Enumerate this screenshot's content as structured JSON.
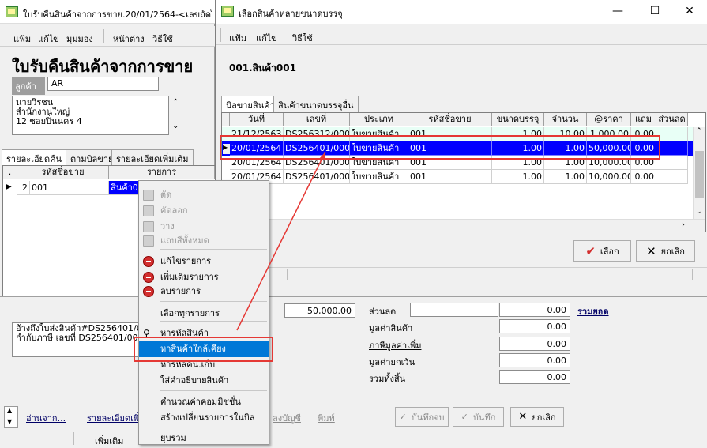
{
  "back_window": {
    "title": "ใบรับคืนสินค้าจากการขาย.20/01/2564-<เลขถัดไป> ,",
    "menu": [
      "แฟ้ม",
      "แก้ไข",
      "มุมมอง",
      "หน้าต่าง",
      "วิธีใช้"
    ],
    "heading": "ใบรับคืนสินค้าจากการขาย",
    "customer_label": "ลูกค้า",
    "customer_code": "AR",
    "address_lines": [
      "นายวิรชน",
      "สำนักงานใหญ่",
      "12 ซอยปิ่นนคร 4"
    ],
    "tabs": [
      "รายละเอียดคืน",
      "ตามบิลขาย",
      "รายละเอียดเพิ่มเติม"
    ],
    "grid_headers": [
      ".",
      "รหัสชื่อขาย",
      "รายการ"
    ],
    "grid_row": {
      "no": "2",
      "code": "001",
      "item": "สินค้า001"
    },
    "reference_lines": [
      "อ้างถึงใบส่งสินค้า#DS256401/0000",
      "กำกับภาษี เลขที่ DS256401/0000"
    ],
    "bottom_links": [
      "อ่านจาก...",
      "รายละเอียดเพิ่ม"
    ],
    "extra_links": [
      "ลงบัญชี",
      "พิมพ์"
    ],
    "status_add": "เพิ่มเติม",
    "amount_value": "50,000.00",
    "summary": {
      "discount_label": "ส่วนลด",
      "discount_value": "0.00",
      "goods_value_label": "มูลค่าสินค้า",
      "goods_value": "0.00",
      "vat_label": "ภาษีมูลค่าเพิ่ม",
      "vat_value": "0.00",
      "exempt_label": "มูลค่ายกเว้น",
      "exempt_value": "0.00",
      "total_label": "รวมทั้งสิ้น",
      "total_value": "0.00",
      "sum_link": "รวมยอด"
    },
    "buttons": {
      "save_print": "บันทึกจบ",
      "save": "บันทึก",
      "cancel": "ยกเลิก"
    }
  },
  "context_menu": {
    "items": [
      {
        "label": "ตัด",
        "disabled": true
      },
      {
        "label": "คัดลอก",
        "disabled": true
      },
      {
        "label": "วาง",
        "disabled": true
      },
      {
        "label": "แถบสีทั้งหมด",
        "disabled": true
      },
      {
        "label": "แก้ไขรายการ",
        "disabled": false
      },
      {
        "label": "เพิ่มเติมรายการ",
        "disabled": false
      },
      {
        "label": "ลบรายการ",
        "disabled": false
      },
      {
        "label": "เลือกทุกรายการ",
        "disabled": false
      },
      {
        "label": "หารหัสสินค้า",
        "disabled": false
      },
      {
        "label": "หาสินค้าใกล้เคียง",
        "disabled": false
      },
      {
        "label": "หารหัสคน.เก็บ",
        "disabled": false
      },
      {
        "label": "ใส่คำอธิบายสินค้า",
        "disabled": false
      },
      {
        "label": "คำนวณค่าคอมมิชชั่น",
        "disabled": false
      },
      {
        "label": "สร้างเปลี่ยนรายการในบิล",
        "disabled": false
      },
      {
        "label": "ยุบรวม",
        "disabled": false
      }
    ],
    "highlight_color": "#0078d7"
  },
  "front_window": {
    "title": "เลือกสินค้าหลายขนาดบรรจุ",
    "menu": [
      "แฟ้ม",
      "แก้ไข",
      "วิธีใช้"
    ],
    "product_title": "001.สินค้า001",
    "tabs": [
      "บิลขายสินค้า",
      "สินค้าขนาดบรรจุอื่น"
    ],
    "columns": [
      "วันที่",
      "เลขที่",
      "ประเภท",
      "รหัสชื่อขาย",
      "ขนาดบรรจุ",
      "จำนวน",
      "@ราคา",
      "แถม",
      "ส่วนลด"
    ],
    "rows": [
      [
        "21/12/2563",
        "DS256312/00005",
        "ใบขายสินค้า",
        "001",
        "1.00",
        "10.00",
        "1,000.00",
        "0.00",
        ""
      ],
      [
        "20/01/2564",
        "DS256401/00004",
        "ใบขายสินค้า",
        "001",
        "1.00",
        "1.00",
        "50,000.00",
        "0.00",
        ""
      ],
      [
        "20/01/2564",
        "DS256401/00005",
        "ใบขายสินค้า",
        "001",
        "1.00",
        "1.00",
        "10,000.00",
        "0.00",
        ""
      ],
      [
        "20/01/2564",
        "DS256401/00006",
        "ใบขายสินค้า",
        "001",
        "1.00",
        "1.00",
        "10,000.00",
        "0.00",
        ""
      ]
    ],
    "selected_row": 1,
    "buttons": {
      "select": "เลือก",
      "cancel": "ยกเลิก"
    },
    "selection_color": "#0000ff",
    "callout_color": "#e53935"
  }
}
